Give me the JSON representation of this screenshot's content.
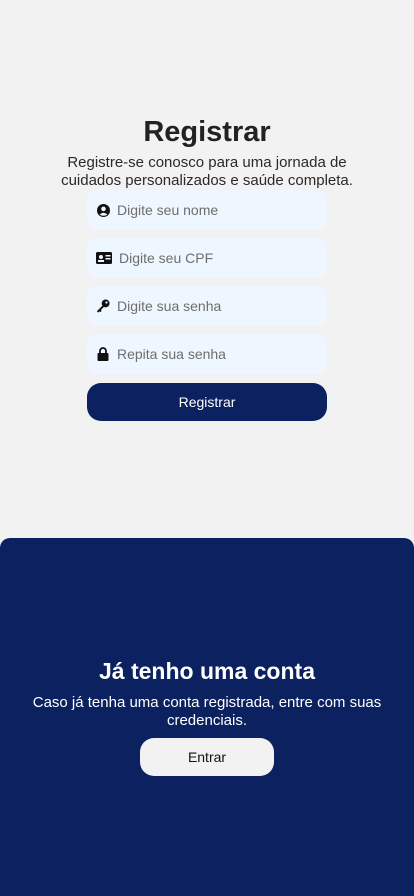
{
  "register": {
    "title": "Registrar",
    "subtitle": "Registre-se conosco para uma jornada de cuidados personalizados e saúde completa.",
    "fields": [
      {
        "placeholder": "Digite seu nome",
        "icon": "user-circle-icon"
      },
      {
        "placeholder": "Digite seu CPF",
        "icon": "id-card-icon"
      },
      {
        "placeholder": "Digite sua senha",
        "icon": "key-icon"
      },
      {
        "placeholder": "Repita sua senha",
        "icon": "lock-icon"
      }
    ],
    "button_label": "Registrar"
  },
  "login": {
    "title": "Já tenho uma conta",
    "subtitle": "Caso já tenha uma conta registrada, entre com suas credenciais.",
    "button_label": "Entrar"
  },
  "colors": {
    "primary": "#0c2160",
    "input_bg": "#eef6ff",
    "page_bg": "#f2f2f2"
  }
}
